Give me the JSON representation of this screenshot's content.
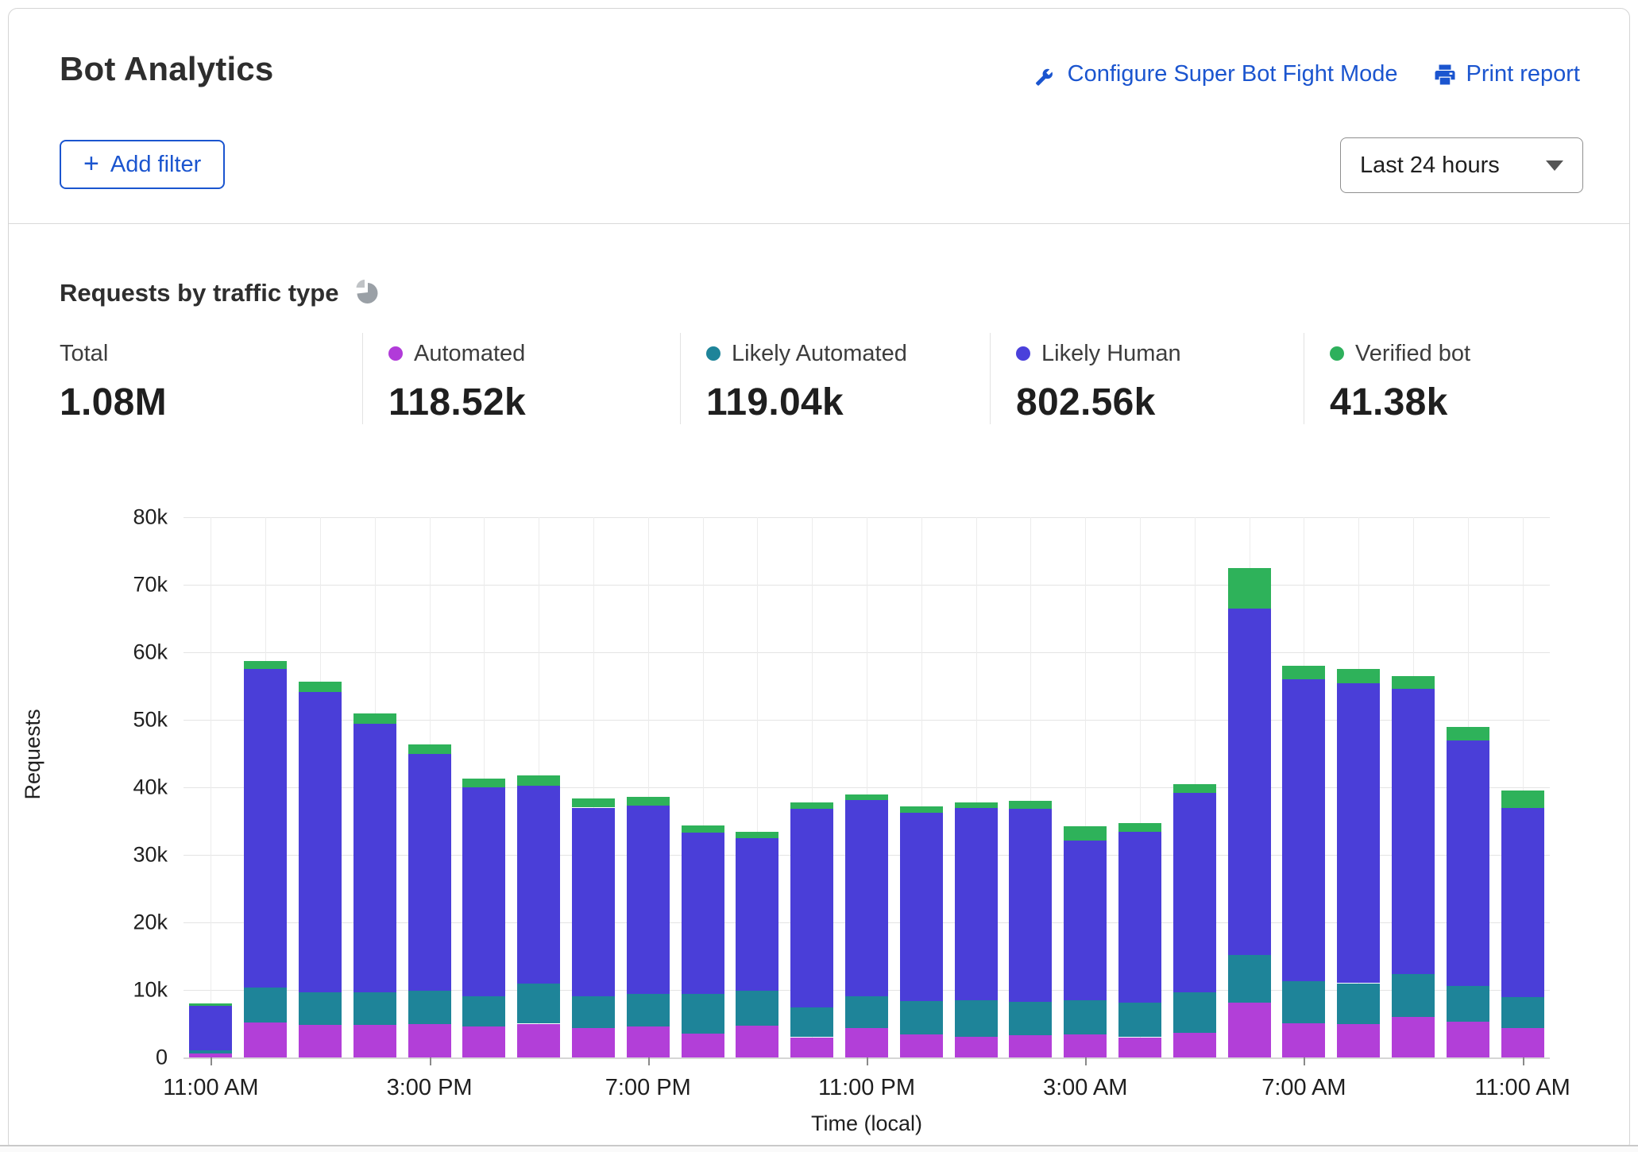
{
  "card": {
    "title": "Bot Analytics",
    "actions": [
      {
        "icon": "wrench-icon",
        "label": "Configure Super Bot Fight Mode"
      },
      {
        "icon": "printer-icon",
        "label": "Print report"
      }
    ],
    "add_filter_plus": "+",
    "add_filter_label": "Add filter",
    "time_range": "Last 24 hours"
  },
  "section": {
    "heading": "Requests by traffic type"
  },
  "stats": [
    {
      "label": "Total",
      "value": "1.08M",
      "color": null
    },
    {
      "label": "Automated",
      "value": "118.52k",
      "color": "#b13bd9"
    },
    {
      "label": "Likely Automated",
      "value": "119.04k",
      "color": "#1e8499"
    },
    {
      "label": "Likely Human",
      "value": "802.56k",
      "color": "#4a40db"
    },
    {
      "label": "Verified bot",
      "value": "41.38k",
      "color": "#2eb05c"
    }
  ],
  "chart_data": {
    "type": "bar",
    "stacked": true,
    "title": "Requests by traffic type",
    "xlabel": "Time (local)",
    "ylabel": "Requests",
    "ylim": [
      0,
      80000
    ],
    "grid": true,
    "legend_position": "top",
    "ytick_labels": [
      "0",
      "10k",
      "20k",
      "30k",
      "40k",
      "50k",
      "60k",
      "70k",
      "80k"
    ],
    "xtick_labels": [
      "11:00 AM",
      "3:00 PM",
      "7:00 PM",
      "11:00 PM",
      "3:00 AM",
      "7:00 AM",
      "11:00 AM"
    ],
    "xtick_every": 4,
    "categories": [
      "11:00 AM",
      "12:00 PM",
      "1:00 PM",
      "2:00 PM",
      "3:00 PM",
      "4:00 PM",
      "5:00 PM",
      "6:00 PM",
      "7:00 PM",
      "8:00 PM",
      "9:00 PM",
      "10:00 PM",
      "11:00 PM",
      "12:00 AM",
      "1:00 AM",
      "2:00 AM",
      "3:00 AM",
      "4:00 AM",
      "5:00 AM",
      "6:00 AM",
      "7:00 AM",
      "8:00 AM",
      "9:00 AM",
      "10:00 AM",
      "11:00 AM"
    ],
    "series": [
      {
        "name": "Automated",
        "color": "#b23fd8",
        "values": [
          600,
          5200,
          4800,
          4800,
          4900,
          4600,
          5000,
          4300,
          4600,
          3500,
          4700,
          3000,
          4400,
          3400,
          3100,
          3300,
          3400,
          3000,
          3700,
          8100,
          5100,
          4900,
          6000,
          5300,
          4300
        ]
      },
      {
        "name": "Likely Automated",
        "color": "#1e8499",
        "values": [
          500,
          5200,
          4900,
          4800,
          5000,
          4500,
          5900,
          4800,
          4800,
          5900,
          5200,
          4400,
          4700,
          4900,
          5400,
          4900,
          5100,
          5100,
          5900,
          7100,
          6200,
          6100,
          6300,
          5300,
          4700
        ]
      },
      {
        "name": "Likely Human",
        "color": "#4a3ed8",
        "values": [
          6600,
          47100,
          44400,
          39800,
          35000,
          30900,
          29300,
          27900,
          27900,
          23900,
          22600,
          29400,
          29000,
          27900,
          28400,
          28600,
          23600,
          25300,
          29600,
          51300,
          44700,
          44400,
          42300,
          36300,
          28000
        ]
      },
      {
        "name": "Verified bot",
        "color": "#2eb25a",
        "values": [
          300,
          1200,
          1600,
          1600,
          1500,
          1300,
          1600,
          1300,
          1300,
          1000,
          900,
          1000,
          900,
          1000,
          900,
          1200,
          2100,
          1300,
          1300,
          6000,
          2000,
          2100,
          1900,
          2100,
          2500
        ]
      }
    ]
  }
}
